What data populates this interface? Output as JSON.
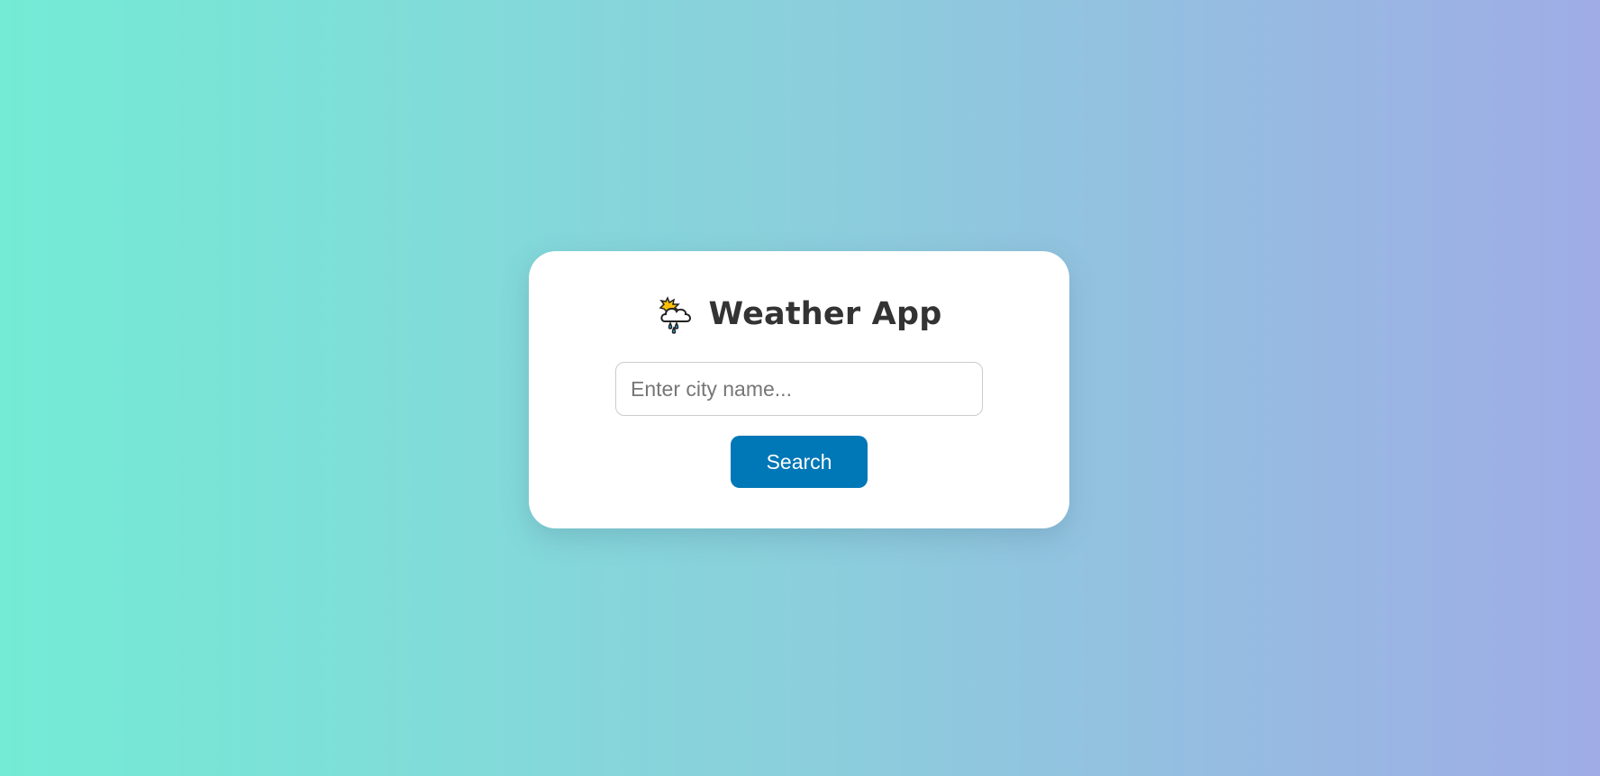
{
  "app": {
    "title": "Weather App",
    "title_icon": "sun-behind-rain-cloud-icon"
  },
  "search": {
    "placeholder": "Enter city name...",
    "value": "",
    "button_label": "Search"
  },
  "colors": {
    "background_gradient_start": "#74ebd5",
    "background_gradient_end": "#9face6",
    "card_background": "#ffffff",
    "button_background": "#0077b6",
    "button_text": "#ffffff",
    "title_text": "#333333"
  }
}
